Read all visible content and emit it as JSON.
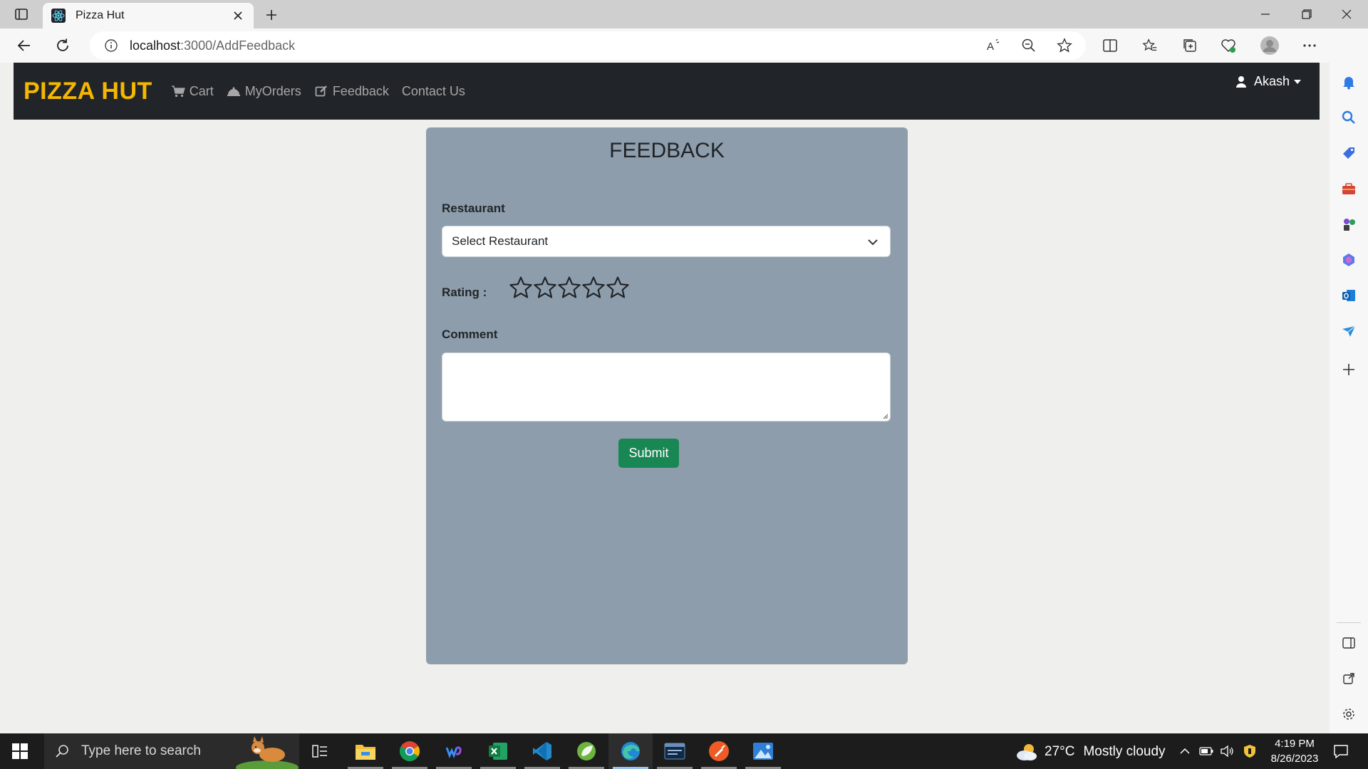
{
  "browser": {
    "tab_title": "Pizza Hut",
    "url_host": "localhost",
    "url_rest": ":3000/AddFeedback"
  },
  "navbar": {
    "brand": "PIZZA HUT",
    "links": [
      {
        "label": "Cart",
        "icon": "cart-icon"
      },
      {
        "label": "MyOrders",
        "icon": "bell-icon"
      },
      {
        "label": "Feedback",
        "icon": "edit-icon"
      },
      {
        "label": "Contact Us",
        "icon": ""
      }
    ],
    "user": "Akash"
  },
  "form": {
    "title": "FEEDBACK",
    "restaurant_label": "Restaurant",
    "restaurant_selected": "Select Restaurant",
    "rating_label": "Rating :",
    "rating_value": 0,
    "rating_max": 5,
    "comment_label": "Comment",
    "comment_value": "",
    "submit_label": "Submit"
  },
  "colors": {
    "navbar_bg": "#212529",
    "brand": "#f5b700",
    "card_bg": "#8e9dab",
    "submit_bg": "#198754"
  },
  "taskbar": {
    "search_placeholder": "Type here to search",
    "weather_temp": "27°C",
    "weather_text": "Mostly cloudy",
    "time": "4:19 PM",
    "date": "8/26/2023"
  }
}
